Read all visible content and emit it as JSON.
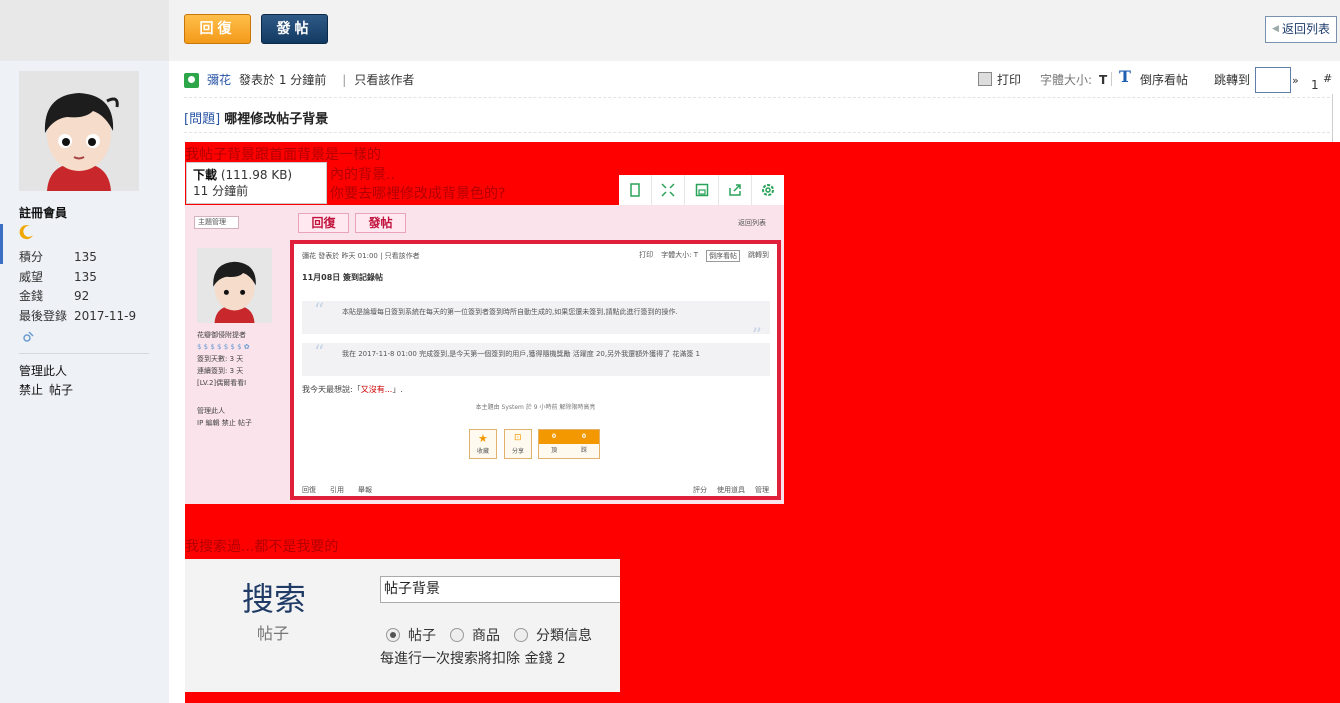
{
  "toolbar": {
    "reply_label": "回復",
    "post_label": "發帖",
    "back_label": "返回列表"
  },
  "author": {
    "name": "彌花",
    "posted": "發表於 1 分鐘前",
    "separator": "|",
    "only_author": "只看該作者"
  },
  "tools": {
    "print": "打印",
    "font_size": "字體大小:",
    "font_t": "T",
    "reverse_t": "T",
    "reverse": "倒序看帖",
    "jump": "跳轉到",
    "jump_go": "»",
    "page": "1",
    "hash": "#"
  },
  "thread": {
    "category": "[問題]",
    "title": "哪裡修改帖子背景"
  },
  "sidebar": {
    "group": "註冊會員",
    "stats": [
      {
        "k": "積分",
        "v": "135"
      },
      {
        "k": "威望",
        "v": "135"
      },
      {
        "k": "金錢",
        "v": "92"
      },
      {
        "k": "最後登錄",
        "v": "2017-11-9"
      }
    ],
    "manage": "管理此人",
    "ban": "禁止",
    "posts": "帖子"
  },
  "body": {
    "line1": "我帖子背景跟首面背景是一樣的",
    "line2": "內的背景..",
    "line3": "你要去哪裡修改成背景色的?",
    "line4": "我搜索過...都不是我要的"
  },
  "download": {
    "label": "下載",
    "size": "(111.98 KB)",
    "time": "11 分鐘前"
  },
  "shot": {
    "select": "主題管理",
    "reply": "回復",
    "post": "發帖",
    "back": "返回列表",
    "user_title": "花瓣御侵附提者",
    "l1": "簽到天數: 3 天",
    "l2": "連續簽到: 3 天",
    "l3": "[LV.2]偶爾看看I",
    "manage": "管理此人",
    "manage2": "IP 編輯 禁止 帖子",
    "head_left": "彌花 發表於 昨天 01:00 | 只看該作者",
    "print": "打印",
    "font": "字體大小: T",
    "reverse": "倒序看帖",
    "jump": "跳轉到",
    "title": "11月08日 簽到記錄帖",
    "q1": "本貼是論壇每日簽到系統在每天的第一位簽到者簽到時所自動生成的,如果您還未簽到,請點此進行簽到的操作.",
    "q2": "我在 2017-11-8 01:00 完成簽到,是今天第一個簽到的用戶,獲得隨機獎勵 活躍度 20,另外我還額外獲得了 花滿簽 1",
    "sig": "我今天最想說:「",
    "sig_red": "又沒有...",
    "sig_end": "」.",
    "note": "本主題由 System 於 9 小時前 解除限時高亮",
    "fav": "收藏",
    "share": "分享",
    "vote_a": "0",
    "vote_b": "0",
    "vote_a_label": "頂",
    "vote_b_label": "踩",
    "f_reply": "回復",
    "f_quote": "引用",
    "f_report": "舉報",
    "f_rate": "評分",
    "f_tools": "使用道具",
    "f_manage": "管理"
  },
  "search": {
    "title": "搜索",
    "subtitle": "帖子",
    "value": "帖子背景",
    "options": [
      "帖子",
      "商品",
      "分類信息"
    ],
    "cost": "每進行一次搜索將扣除 金錢 2"
  },
  "colors": {
    "background_red": "#ff0000",
    "accent_blue": "#2a56a5",
    "reply_orange": "#f39a1a",
    "post_navy": "#123a62"
  }
}
